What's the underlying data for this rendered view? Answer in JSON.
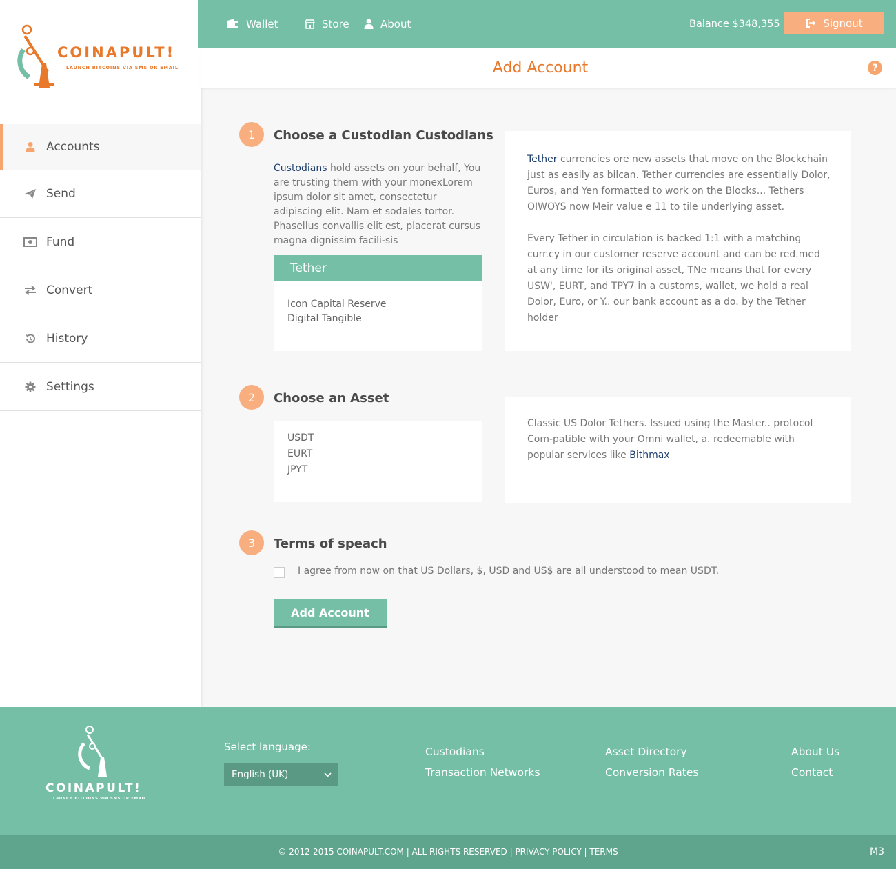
{
  "brand": {
    "name": "COINAPULT!",
    "tagline": "LAUNCH BITCOINS VIA SMS OR EMAIL",
    "footer_name": "COINAPULT!",
    "accent": "#76bfa7",
    "orange": "#e8782a",
    "peach": "#f9ae7f"
  },
  "topnav": {
    "wallet": "Wallet",
    "store": "Store",
    "about": "About",
    "balance": "Balance $348,355",
    "signout": "Signout"
  },
  "page": {
    "title": "Add Account"
  },
  "sidebar": {
    "items": [
      {
        "label": "Accounts",
        "icon": "user-icon"
      },
      {
        "label": "Send",
        "icon": "paper-plane-icon"
      },
      {
        "label": "Fund",
        "icon": "money-icon"
      },
      {
        "label": "Convert",
        "icon": "exchange-icon"
      },
      {
        "label": "History",
        "icon": "history-icon"
      },
      {
        "label": "Settings",
        "icon": "gear-icon"
      }
    ]
  },
  "step1": {
    "number": "1",
    "title": "Choose a Custodian Custodians",
    "link": "Custodians",
    "text": " hold assets on your behalf, You are trusting them with your monexLorem ipsum dolor sit amet, consectetur adipiscing elit. Nam et sodales tortor. Phasellus convallis elit est, placerat cursus magna dignissim facili-sis",
    "card_header": "Tether",
    "options": [
      "Icon Capital Reserve",
      "Digital Tangible"
    ],
    "info_link": "Tether",
    "info_p1": " currencies ore new assets that move on the Blockchain just as easily as bilcan. Tether currencies are essentially Dolor, Euros, and Yen formatted to work on the Blocks... Tethers OIWOYS now Meir value e 11 to tile underlying asset.",
    "info_p2": "Every Tether in circulation is backed 1:1 with a matching curr.cy in our customer reserve account and can be red.med at any time for its original asset, TNe means that for every USW', EURT, and TPY7 in a customs, wallet, we hold a real Dolor, Euro, or Y.. our bank account as a do. by the Tether holder"
  },
  "step2": {
    "number": "2",
    "title": "Choose an Asset",
    "options": [
      "USDT",
      "EURT",
      "JPYT"
    ],
    "info_text": "Classic US Dolor Tethers. Issued using the Master.. protocol Com-patible with your Omni wallet, a. redeemable with popular services like ",
    "info_link": "Bithmax"
  },
  "step3": {
    "number": "3",
    "title": "Terms of speach",
    "agree": "I agree from now on that US Dollars, $, USD and US$ are all understood to mean USDT.",
    "button": "Add Account"
  },
  "footer": {
    "lang_label": "Select language:",
    "lang_value": "English (UK)",
    "col1": [
      "Custodians",
      "Transaction Networks"
    ],
    "col2": [
      "Asset Directory",
      "Conversion Rates"
    ],
    "col3": [
      "About Us",
      "Contact"
    ],
    "copyright": "© 2012-2015 COINAPULT.COM | ALL RIGHTS RESERVED | PRIVACY POLICY | TERMS",
    "version": "M3"
  }
}
